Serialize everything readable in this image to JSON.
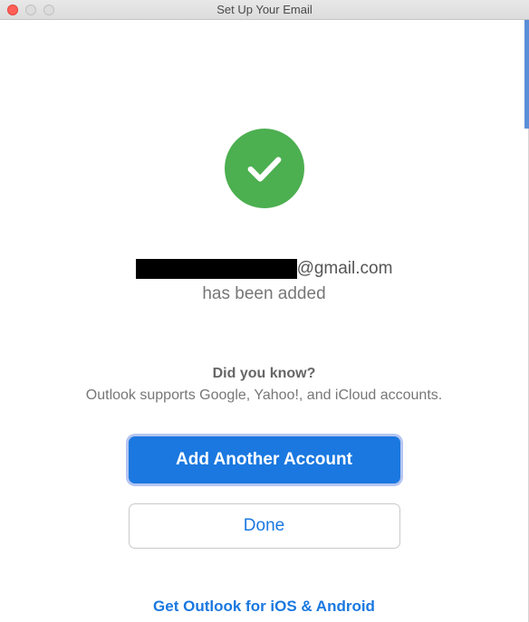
{
  "window": {
    "title": "Set Up Your Email"
  },
  "success": {
    "icon_name": "checkmark",
    "email_redacted": true,
    "email_suffix": "@gmail.com",
    "added_text": "has been added"
  },
  "tip": {
    "heading": "Did you know?",
    "body": "Outlook supports Google, Yahoo!, and iCloud accounts."
  },
  "buttons": {
    "primary": "Add Another Account",
    "secondary": "Done"
  },
  "footer_link": "Get Outlook for iOS & Android",
  "colors": {
    "success_green": "#4caf50",
    "primary_blue": "#1a78e0"
  }
}
